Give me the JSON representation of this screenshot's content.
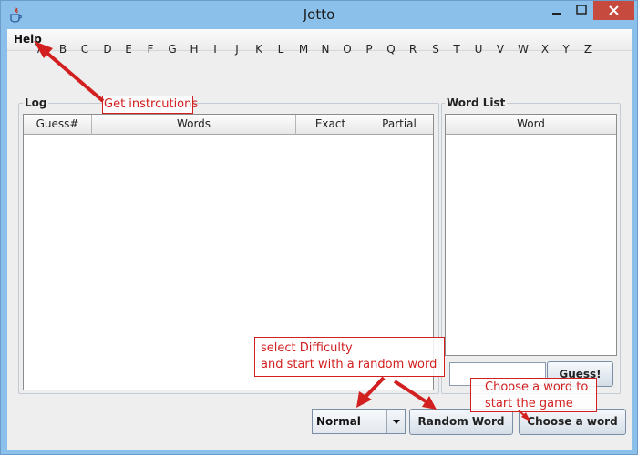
{
  "window": {
    "title": "Jotto"
  },
  "menu": {
    "help": "Help"
  },
  "letters": [
    "A",
    "B",
    "C",
    "D",
    "E",
    "F",
    "G",
    "H",
    "I",
    "J",
    "K",
    "L",
    "M",
    "N",
    "O",
    "P",
    "Q",
    "R",
    "S",
    "T",
    "U",
    "V",
    "W",
    "X",
    "Y",
    "Z"
  ],
  "log": {
    "title": "Log",
    "columns": [
      "Guess#",
      "Words",
      "Exact",
      "Partial"
    ],
    "rows": []
  },
  "word_list": {
    "title": "Word List",
    "column": "Word",
    "rows": []
  },
  "guess": {
    "value": "",
    "button": "Guess!"
  },
  "difficulty": {
    "selected": "Normal"
  },
  "buttons": {
    "random_word": "Random Word",
    "choose_word": "Choose a word"
  },
  "annotations": {
    "instructions": "Get instrcutions",
    "difficulty": "select Difficulty\nand start with a random word",
    "choose": "Choose a word to\nstart the game"
  },
  "colors": {
    "titlebar": "#8bc0ea",
    "close_button": "#c74a3f",
    "annotation": "#d21f1f",
    "panel_bg": "#eeeeee"
  }
}
